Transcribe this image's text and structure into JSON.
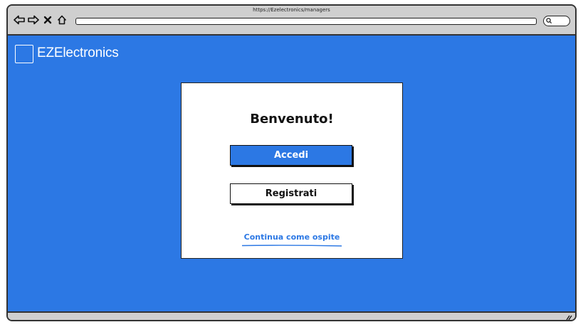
{
  "browser": {
    "url": "https://Ezelectronics/managers",
    "nav_icons": [
      "back-arrow-icon",
      "forward-arrow-icon",
      "close-icon",
      "home-icon"
    ],
    "search_icon": "search-icon"
  },
  "header": {
    "brand": "EZElectronics",
    "logo": "logo-placeholder"
  },
  "welcome_card": {
    "title": "Benvenuto!",
    "login_label": "Accedi",
    "register_label": "Registrati",
    "guest_label": "Continua come ospite"
  },
  "colors": {
    "accent": "#2c78e4",
    "card_bg": "#ffffff",
    "chrome": "#cfcfcf"
  }
}
